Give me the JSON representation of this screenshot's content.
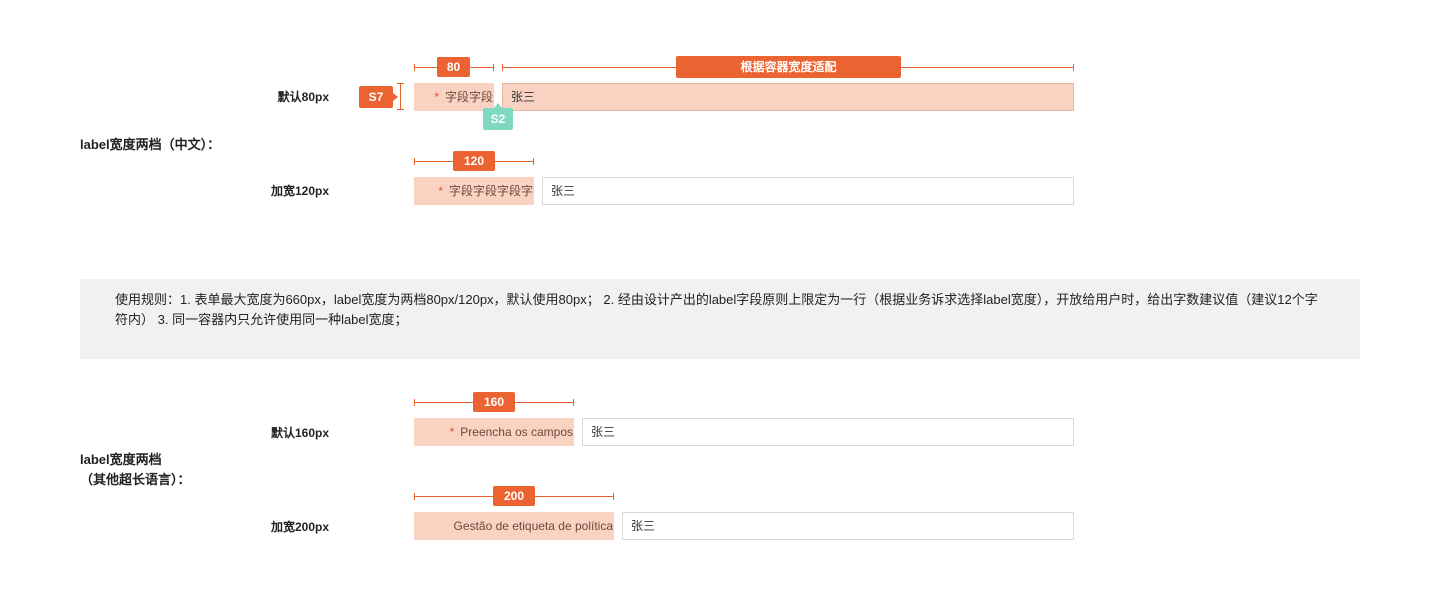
{
  "section1": {
    "title": "label宽度两档（中文）：",
    "default_row": {
      "label": "默认80px",
      "width_tag": "80",
      "container_tag": "根据容器宽度适配",
      "spacing_left": "S7",
      "spacing_gap": "S2",
      "required_mark": "*",
      "field_label": "字段字段",
      "field_value": "张三"
    },
    "wide_row": {
      "label": "加宽120px",
      "width_tag": "120",
      "required_mark": "*",
      "field_label": "字段字段字段字",
      "field_value": "张三"
    }
  },
  "rules": {
    "text": "使用规则：1. 表单最大宽度为660px，label宽度为两档80px/120px，默认使用80px；  2. 经由设计产出的label字段原则上限定为一行（根据业务诉求选择label宽度），开放给用户时，给出字数建议值（建议12个字符内）  3. 同一容器内只允许使用同一种label宽度；"
  },
  "section2": {
    "title_line1": "label宽度两档",
    "title_line2": "（其他超长语言）：",
    "default_row": {
      "label": "默认160px",
      "width_tag": "160",
      "required_mark": "*",
      "field_label": "Preencha os campos",
      "field_value": "张三"
    },
    "wide_row": {
      "label": "加宽200px",
      "width_tag": "200",
      "field_label": "Gestão de etiqueta de política",
      "field_value": "张三"
    }
  },
  "colors": {
    "accent": "#ea6330",
    "label_bg": "#f9d2c1",
    "spacing_teal": "#7fd9c2",
    "rules_bg": "#f1f1f1"
  }
}
